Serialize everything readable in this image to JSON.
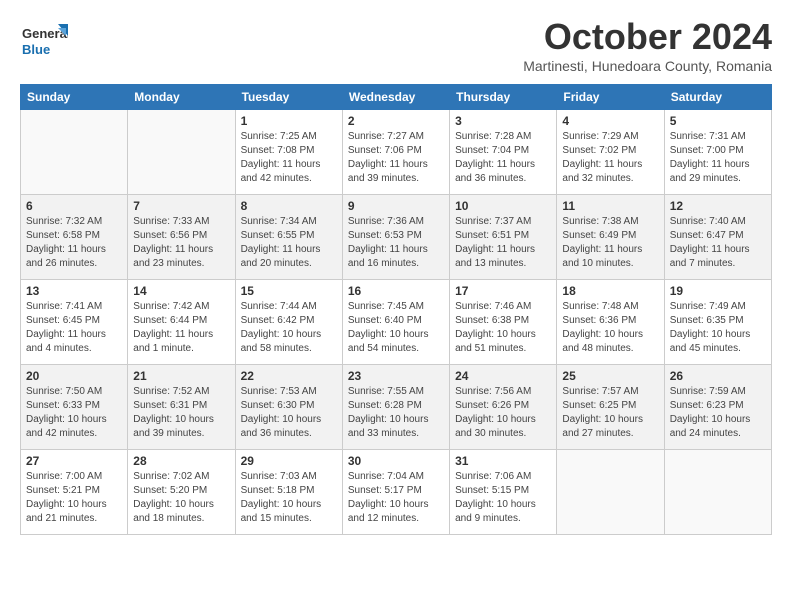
{
  "header": {
    "logo_general": "General",
    "logo_blue": "Blue",
    "month_title": "October 2024",
    "location": "Martinesti, Hunedoara County, Romania"
  },
  "days_of_week": [
    "Sunday",
    "Monday",
    "Tuesday",
    "Wednesday",
    "Thursday",
    "Friday",
    "Saturday"
  ],
  "weeks": [
    [
      {
        "day": "",
        "sunrise": "",
        "sunset": "",
        "daylight": "",
        "empty": true
      },
      {
        "day": "",
        "sunrise": "",
        "sunset": "",
        "daylight": "",
        "empty": true
      },
      {
        "day": "1",
        "sunrise": "Sunrise: 7:25 AM",
        "sunset": "Sunset: 7:08 PM",
        "daylight": "Daylight: 11 hours and 42 minutes."
      },
      {
        "day": "2",
        "sunrise": "Sunrise: 7:27 AM",
        "sunset": "Sunset: 7:06 PM",
        "daylight": "Daylight: 11 hours and 39 minutes."
      },
      {
        "day": "3",
        "sunrise": "Sunrise: 7:28 AM",
        "sunset": "Sunset: 7:04 PM",
        "daylight": "Daylight: 11 hours and 36 minutes."
      },
      {
        "day": "4",
        "sunrise": "Sunrise: 7:29 AM",
        "sunset": "Sunset: 7:02 PM",
        "daylight": "Daylight: 11 hours and 32 minutes."
      },
      {
        "day": "5",
        "sunrise": "Sunrise: 7:31 AM",
        "sunset": "Sunset: 7:00 PM",
        "daylight": "Daylight: 11 hours and 29 minutes."
      }
    ],
    [
      {
        "day": "6",
        "sunrise": "Sunrise: 7:32 AM",
        "sunset": "Sunset: 6:58 PM",
        "daylight": "Daylight: 11 hours and 26 minutes."
      },
      {
        "day": "7",
        "sunrise": "Sunrise: 7:33 AM",
        "sunset": "Sunset: 6:56 PM",
        "daylight": "Daylight: 11 hours and 23 minutes."
      },
      {
        "day": "8",
        "sunrise": "Sunrise: 7:34 AM",
        "sunset": "Sunset: 6:55 PM",
        "daylight": "Daylight: 11 hours and 20 minutes."
      },
      {
        "day": "9",
        "sunrise": "Sunrise: 7:36 AM",
        "sunset": "Sunset: 6:53 PM",
        "daylight": "Daylight: 11 hours and 16 minutes."
      },
      {
        "day": "10",
        "sunrise": "Sunrise: 7:37 AM",
        "sunset": "Sunset: 6:51 PM",
        "daylight": "Daylight: 11 hours and 13 minutes."
      },
      {
        "day": "11",
        "sunrise": "Sunrise: 7:38 AM",
        "sunset": "Sunset: 6:49 PM",
        "daylight": "Daylight: 11 hours and 10 minutes."
      },
      {
        "day": "12",
        "sunrise": "Sunrise: 7:40 AM",
        "sunset": "Sunset: 6:47 PM",
        "daylight": "Daylight: 11 hours and 7 minutes."
      }
    ],
    [
      {
        "day": "13",
        "sunrise": "Sunrise: 7:41 AM",
        "sunset": "Sunset: 6:45 PM",
        "daylight": "Daylight: 11 hours and 4 minutes."
      },
      {
        "day": "14",
        "sunrise": "Sunrise: 7:42 AM",
        "sunset": "Sunset: 6:44 PM",
        "daylight": "Daylight: 11 hours and 1 minute."
      },
      {
        "day": "15",
        "sunrise": "Sunrise: 7:44 AM",
        "sunset": "Sunset: 6:42 PM",
        "daylight": "Daylight: 10 hours and 58 minutes."
      },
      {
        "day": "16",
        "sunrise": "Sunrise: 7:45 AM",
        "sunset": "Sunset: 6:40 PM",
        "daylight": "Daylight: 10 hours and 54 minutes."
      },
      {
        "day": "17",
        "sunrise": "Sunrise: 7:46 AM",
        "sunset": "Sunset: 6:38 PM",
        "daylight": "Daylight: 10 hours and 51 minutes."
      },
      {
        "day": "18",
        "sunrise": "Sunrise: 7:48 AM",
        "sunset": "Sunset: 6:36 PM",
        "daylight": "Daylight: 10 hours and 48 minutes."
      },
      {
        "day": "19",
        "sunrise": "Sunrise: 7:49 AM",
        "sunset": "Sunset: 6:35 PM",
        "daylight": "Daylight: 10 hours and 45 minutes."
      }
    ],
    [
      {
        "day": "20",
        "sunrise": "Sunrise: 7:50 AM",
        "sunset": "Sunset: 6:33 PM",
        "daylight": "Daylight: 10 hours and 42 minutes."
      },
      {
        "day": "21",
        "sunrise": "Sunrise: 7:52 AM",
        "sunset": "Sunset: 6:31 PM",
        "daylight": "Daylight: 10 hours and 39 minutes."
      },
      {
        "day": "22",
        "sunrise": "Sunrise: 7:53 AM",
        "sunset": "Sunset: 6:30 PM",
        "daylight": "Daylight: 10 hours and 36 minutes."
      },
      {
        "day": "23",
        "sunrise": "Sunrise: 7:55 AM",
        "sunset": "Sunset: 6:28 PM",
        "daylight": "Daylight: 10 hours and 33 minutes."
      },
      {
        "day": "24",
        "sunrise": "Sunrise: 7:56 AM",
        "sunset": "Sunset: 6:26 PM",
        "daylight": "Daylight: 10 hours and 30 minutes."
      },
      {
        "day": "25",
        "sunrise": "Sunrise: 7:57 AM",
        "sunset": "Sunset: 6:25 PM",
        "daylight": "Daylight: 10 hours and 27 minutes."
      },
      {
        "day": "26",
        "sunrise": "Sunrise: 7:59 AM",
        "sunset": "Sunset: 6:23 PM",
        "daylight": "Daylight: 10 hours and 24 minutes."
      }
    ],
    [
      {
        "day": "27",
        "sunrise": "Sunrise: 7:00 AM",
        "sunset": "Sunset: 5:21 PM",
        "daylight": "Daylight: 10 hours and 21 minutes."
      },
      {
        "day": "28",
        "sunrise": "Sunrise: 7:02 AM",
        "sunset": "Sunset: 5:20 PM",
        "daylight": "Daylight: 10 hours and 18 minutes."
      },
      {
        "day": "29",
        "sunrise": "Sunrise: 7:03 AM",
        "sunset": "Sunset: 5:18 PM",
        "daylight": "Daylight: 10 hours and 15 minutes."
      },
      {
        "day": "30",
        "sunrise": "Sunrise: 7:04 AM",
        "sunset": "Sunset: 5:17 PM",
        "daylight": "Daylight: 10 hours and 12 minutes."
      },
      {
        "day": "31",
        "sunrise": "Sunrise: 7:06 AM",
        "sunset": "Sunset: 5:15 PM",
        "daylight": "Daylight: 10 hours and 9 minutes."
      },
      {
        "day": "",
        "sunrise": "",
        "sunset": "",
        "daylight": "",
        "empty": true
      },
      {
        "day": "",
        "sunrise": "",
        "sunset": "",
        "daylight": "",
        "empty": true
      }
    ]
  ]
}
